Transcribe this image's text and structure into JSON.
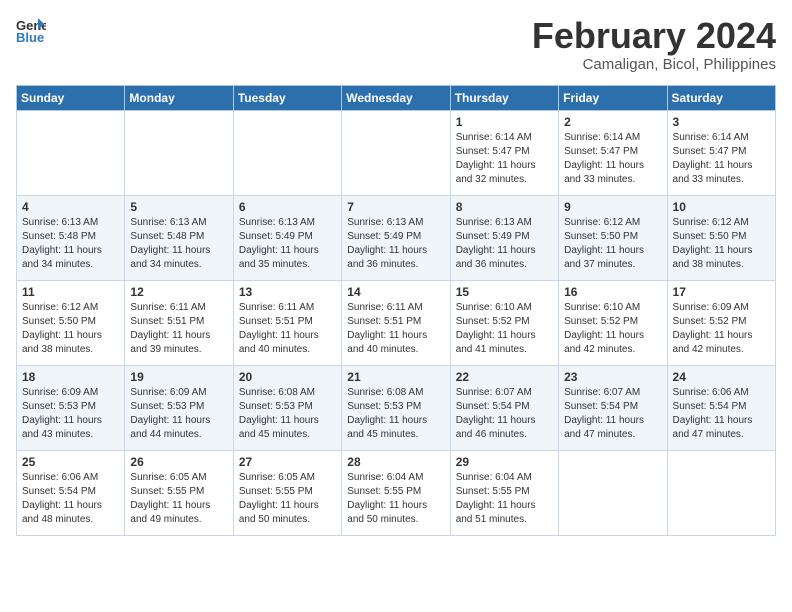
{
  "header": {
    "logo_line1": "General",
    "logo_line2": "Blue",
    "month": "February 2024",
    "location": "Camaligan, Bicol, Philippines"
  },
  "days_of_week": [
    "Sunday",
    "Monday",
    "Tuesday",
    "Wednesday",
    "Thursday",
    "Friday",
    "Saturday"
  ],
  "weeks": [
    [
      {
        "day": "",
        "content": ""
      },
      {
        "day": "",
        "content": ""
      },
      {
        "day": "",
        "content": ""
      },
      {
        "day": "",
        "content": ""
      },
      {
        "day": "1",
        "content": "Sunrise: 6:14 AM\nSunset: 5:47 PM\nDaylight: 11 hours\nand 32 minutes."
      },
      {
        "day": "2",
        "content": "Sunrise: 6:14 AM\nSunset: 5:47 PM\nDaylight: 11 hours\nand 33 minutes."
      },
      {
        "day": "3",
        "content": "Sunrise: 6:14 AM\nSunset: 5:47 PM\nDaylight: 11 hours\nand 33 minutes."
      }
    ],
    [
      {
        "day": "4",
        "content": "Sunrise: 6:13 AM\nSunset: 5:48 PM\nDaylight: 11 hours\nand 34 minutes."
      },
      {
        "day": "5",
        "content": "Sunrise: 6:13 AM\nSunset: 5:48 PM\nDaylight: 11 hours\nand 34 minutes."
      },
      {
        "day": "6",
        "content": "Sunrise: 6:13 AM\nSunset: 5:49 PM\nDaylight: 11 hours\nand 35 minutes."
      },
      {
        "day": "7",
        "content": "Sunrise: 6:13 AM\nSunset: 5:49 PM\nDaylight: 11 hours\nand 36 minutes."
      },
      {
        "day": "8",
        "content": "Sunrise: 6:13 AM\nSunset: 5:49 PM\nDaylight: 11 hours\nand 36 minutes."
      },
      {
        "day": "9",
        "content": "Sunrise: 6:12 AM\nSunset: 5:50 PM\nDaylight: 11 hours\nand 37 minutes."
      },
      {
        "day": "10",
        "content": "Sunrise: 6:12 AM\nSunset: 5:50 PM\nDaylight: 11 hours\nand 38 minutes."
      }
    ],
    [
      {
        "day": "11",
        "content": "Sunrise: 6:12 AM\nSunset: 5:50 PM\nDaylight: 11 hours\nand 38 minutes."
      },
      {
        "day": "12",
        "content": "Sunrise: 6:11 AM\nSunset: 5:51 PM\nDaylight: 11 hours\nand 39 minutes."
      },
      {
        "day": "13",
        "content": "Sunrise: 6:11 AM\nSunset: 5:51 PM\nDaylight: 11 hours\nand 40 minutes."
      },
      {
        "day": "14",
        "content": "Sunrise: 6:11 AM\nSunset: 5:51 PM\nDaylight: 11 hours\nand 40 minutes."
      },
      {
        "day": "15",
        "content": "Sunrise: 6:10 AM\nSunset: 5:52 PM\nDaylight: 11 hours\nand 41 minutes."
      },
      {
        "day": "16",
        "content": "Sunrise: 6:10 AM\nSunset: 5:52 PM\nDaylight: 11 hours\nand 42 minutes."
      },
      {
        "day": "17",
        "content": "Sunrise: 6:09 AM\nSunset: 5:52 PM\nDaylight: 11 hours\nand 42 minutes."
      }
    ],
    [
      {
        "day": "18",
        "content": "Sunrise: 6:09 AM\nSunset: 5:53 PM\nDaylight: 11 hours\nand 43 minutes."
      },
      {
        "day": "19",
        "content": "Sunrise: 6:09 AM\nSunset: 5:53 PM\nDaylight: 11 hours\nand 44 minutes."
      },
      {
        "day": "20",
        "content": "Sunrise: 6:08 AM\nSunset: 5:53 PM\nDaylight: 11 hours\nand 45 minutes."
      },
      {
        "day": "21",
        "content": "Sunrise: 6:08 AM\nSunset: 5:53 PM\nDaylight: 11 hours\nand 45 minutes."
      },
      {
        "day": "22",
        "content": "Sunrise: 6:07 AM\nSunset: 5:54 PM\nDaylight: 11 hours\nand 46 minutes."
      },
      {
        "day": "23",
        "content": "Sunrise: 6:07 AM\nSunset: 5:54 PM\nDaylight: 11 hours\nand 47 minutes."
      },
      {
        "day": "24",
        "content": "Sunrise: 6:06 AM\nSunset: 5:54 PM\nDaylight: 11 hours\nand 47 minutes."
      }
    ],
    [
      {
        "day": "25",
        "content": "Sunrise: 6:06 AM\nSunset: 5:54 PM\nDaylight: 11 hours\nand 48 minutes."
      },
      {
        "day": "26",
        "content": "Sunrise: 6:05 AM\nSunset: 5:55 PM\nDaylight: 11 hours\nand 49 minutes."
      },
      {
        "day": "27",
        "content": "Sunrise: 6:05 AM\nSunset: 5:55 PM\nDaylight: 11 hours\nand 50 minutes."
      },
      {
        "day": "28",
        "content": "Sunrise: 6:04 AM\nSunset: 5:55 PM\nDaylight: 11 hours\nand 50 minutes."
      },
      {
        "day": "29",
        "content": "Sunrise: 6:04 AM\nSunset: 5:55 PM\nDaylight: 11 hours\nand 51 minutes."
      },
      {
        "day": "",
        "content": ""
      },
      {
        "day": "",
        "content": ""
      }
    ]
  ]
}
